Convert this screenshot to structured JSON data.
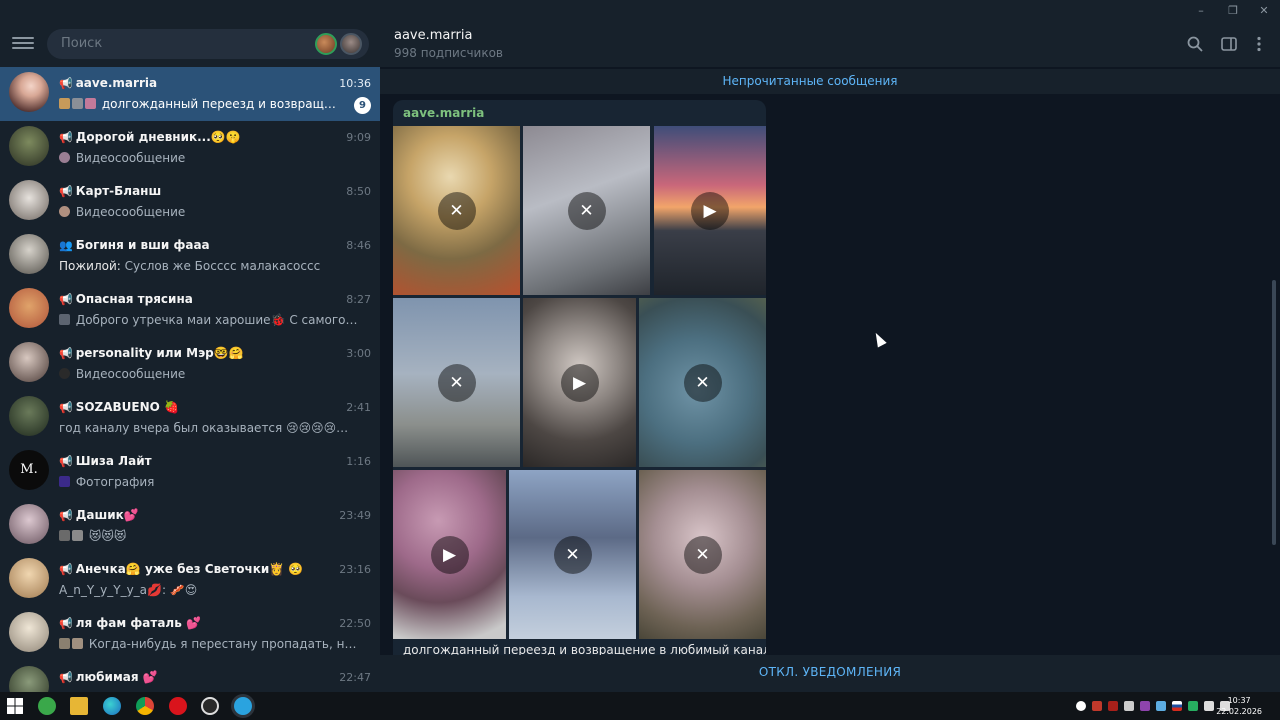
{
  "window": {
    "minimize": "–",
    "maximize": "❐",
    "close": "✕"
  },
  "search": {
    "placeholder": "Поиск"
  },
  "chats": [
    {
      "name": "aave.marria",
      "time": "10:36",
      "message": "долгожданный переезд и возвращение в любимый канал",
      "unread": "9",
      "active": true,
      "icon": "megaphone-icon"
    },
    {
      "name": "Дорогой дневник...🥺🤫",
      "time": "9:09",
      "message": "Видеосообщение",
      "icon": "megaphone-icon"
    },
    {
      "name": "Карт-Бланш",
      "time": "8:50",
      "message": "Видеосообщение",
      "icon": "megaphone-icon"
    },
    {
      "name": "Богиня и вши фааа",
      "time": "8:46",
      "sender": "Пожилой:",
      "message": "Суслов же Боссcс малакасосcс",
      "icon": "group-icon"
    },
    {
      "name": "Опасная трясина",
      "time": "8:27",
      "message": "Доброго утречка маи харошие🐞 С самого утра не...",
      "icon": "megaphone-icon"
    },
    {
      "name": "personality или Мэр🤓🤗",
      "time": "3:00",
      "message": "Видеосообщение",
      "icon": "megaphone-icon"
    },
    {
      "name": "SOZABUENO 🍓",
      "time": "2:41",
      "message": "год каналу вчера был оказывается 😢😢😢😢😢...",
      "icon": "megaphone-icon"
    },
    {
      "name": "Шиза Лайт",
      "time": "1:16",
      "message": "Фотография",
      "icon": "megaphone-icon"
    },
    {
      "name": "Дашик💕",
      "time": "23:49",
      "message": "😻😻😻",
      "icon": "megaphone-icon"
    },
    {
      "name": "Анечка🤗 уже без Светочки👸 🥺",
      "time": "23:16",
      "message": "A_n_Y_y_Y_y_a💋: 🥓😍",
      "icon": "megaphone-icon"
    },
    {
      "name": "ля фам фаталь 💕",
      "time": "22:50",
      "message": "Когда-нибудь я перестану пропадать, но по...",
      "icon": "megaphone-icon"
    },
    {
      "name": "любимая 💕",
      "time": "22:47",
      "message": "",
      "icon": "megaphone-icon"
    }
  ],
  "channel": {
    "title": "aave.marria",
    "subscribers": "998 подписчиков"
  },
  "unread_label": "Непрочитанные сообщения",
  "post": {
    "author": "aave.marria",
    "caption": "долгожданный переезд и возвращение в любимый канал",
    "media": [
      {
        "kind": "photo-hidden",
        "control": "✕"
      },
      {
        "kind": "photo-hidden",
        "control": "✕"
      },
      {
        "kind": "video",
        "control": "▶"
      },
      {
        "kind": "photo-hidden",
        "control": "✕"
      },
      {
        "kind": "video",
        "control": "▶"
      },
      {
        "kind": "photo-hidden",
        "control": "✕"
      },
      {
        "kind": "video",
        "control": "▶"
      },
      {
        "kind": "photo-hidden",
        "control": "✕"
      },
      {
        "kind": "photo-hidden",
        "control": "✕"
      }
    ]
  },
  "footer": {
    "mute_label": "ОТКЛ. УВЕДОМЛЕНИЯ"
  },
  "taskbar": {
    "time": "10:37",
    "date": "22.02.2026"
  },
  "colors": {
    "accent": "#5eb5f7",
    "active_chat": "#2b5278",
    "sidebar": "#17212b",
    "chat_bg": "#0e1621"
  }
}
